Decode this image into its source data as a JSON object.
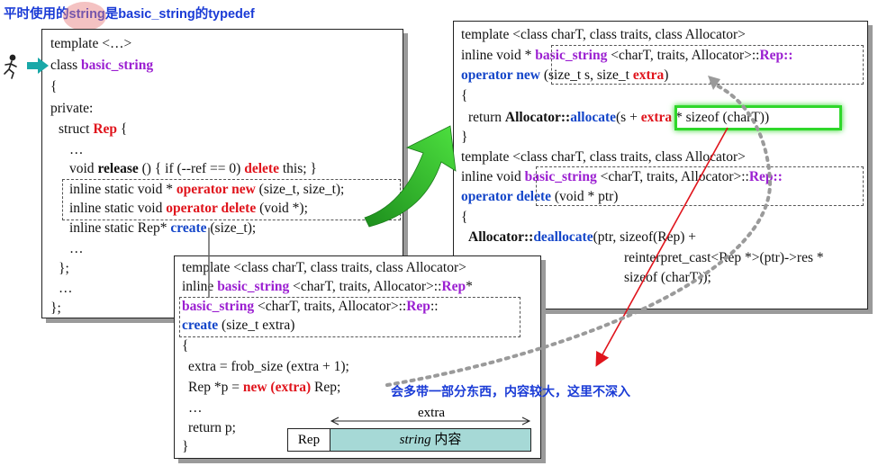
{
  "title": "平时使用的string是basic_string的typedef",
  "note": "会多带一部分东西，内容较大，这里不深入",
  "left_box": {
    "line1": "template <…>",
    "line2_pre": "class ",
    "line2_kw": "basic_string",
    "line3": "{",
    "line4": "private:",
    "line5_pre": "struct ",
    "line5_kw": "Rep",
    "line5_post": " {",
    "line6": "…",
    "line7_pre": "void ",
    "line7_b": "release",
    "line7_mid": " () { if (--ref == 0) ",
    "line7_kw": "delete",
    "line7_post": " this; }",
    "line8_pre": "inline static void * ",
    "line8_kw": "operator new",
    "line8_post": " (size_t, size_t);",
    "line9_pre": "inline static void ",
    "line9_kw": "operator delete",
    "line9_post": " (void *);",
    "line10_pre": "inline static Rep* ",
    "line10_kw": "create",
    "line10_post": " (size_t);",
    "line11": "…",
    "line12": "};",
    "line13": "…",
    "line14": "};"
  },
  "right_box": {
    "l1": "template <class charT, class traits, class Allocator>",
    "l2_pre": "inline void * ",
    "l2_kw": "basic_string",
    "l2_mid": " <charT, traits, Allocator>::",
    "l2_kw2": "Rep",
    "l2_post": "::",
    "l3_kw": "operator new",
    "l3_mid": " (size_t s, size_t ",
    "l3_kw2": "extra",
    "l3_post": ")",
    "l4": "{",
    "l5_pre": "return ",
    "l5_b": "Allocator::",
    "l5_kw": "allocate",
    "l5_mid": "(s + ",
    "l5_kw2": "extra",
    "l5_post": " * sizeof (charT))",
    "l6": "}",
    "l7": "template <class charT, class traits, class Allocator>",
    "l8_pre": "inline void ",
    "l8_kw": "basic_string",
    "l8_mid": " <charT, traits, Allocator>::",
    "l8_kw2": "Rep",
    "l8_post": "::",
    "l9_kw": "operator delete",
    "l9_post": " (void * ptr)",
    "l10": "{",
    "l11_b": "Allocator::",
    "l11_kw": "deallocate",
    "l11_post": "(ptr, sizeof(Rep) +",
    "l12": "reinterpret_cast<Rep *>(ptr)->res *",
    "l13": "sizeof (charT));"
  },
  "bottom_box": {
    "l1": "template <class charT, class traits, class Allocator>",
    "l2_pre": "inline ",
    "l2_kw": "basic_string",
    "l2_mid": " <charT, traits, Allocator>::",
    "l2_kw2": "Rep",
    "l2_post": "*",
    "l3_kw": "basic_string",
    "l3_mid": " <charT, traits, Allocator>::",
    "l3_kw2": "Rep",
    "l3_post": "::",
    "l4_kw": "create",
    "l4_post": " (size_t extra)",
    "l5": "{",
    "l6": "extra = frob_size (extra + 1);",
    "l7_pre": "Rep *p = ",
    "l7_kw": "new (extra)",
    "l7_post": " Rep;",
    "l8": "…",
    "l9": "return p;",
    "l10": "}",
    "diagram_extra": "extra",
    "diagram_rep": "Rep",
    "diagram_content_it": "string",
    "diagram_content": " 内容"
  },
  "colors": {
    "purple": "#9b1fd1",
    "red": "#e0141c",
    "blue": "#1446c9",
    "teal_cell": "#a6d9d6",
    "green_arrow": "#2fbf2a",
    "title_blue": "#1a3bd6"
  }
}
